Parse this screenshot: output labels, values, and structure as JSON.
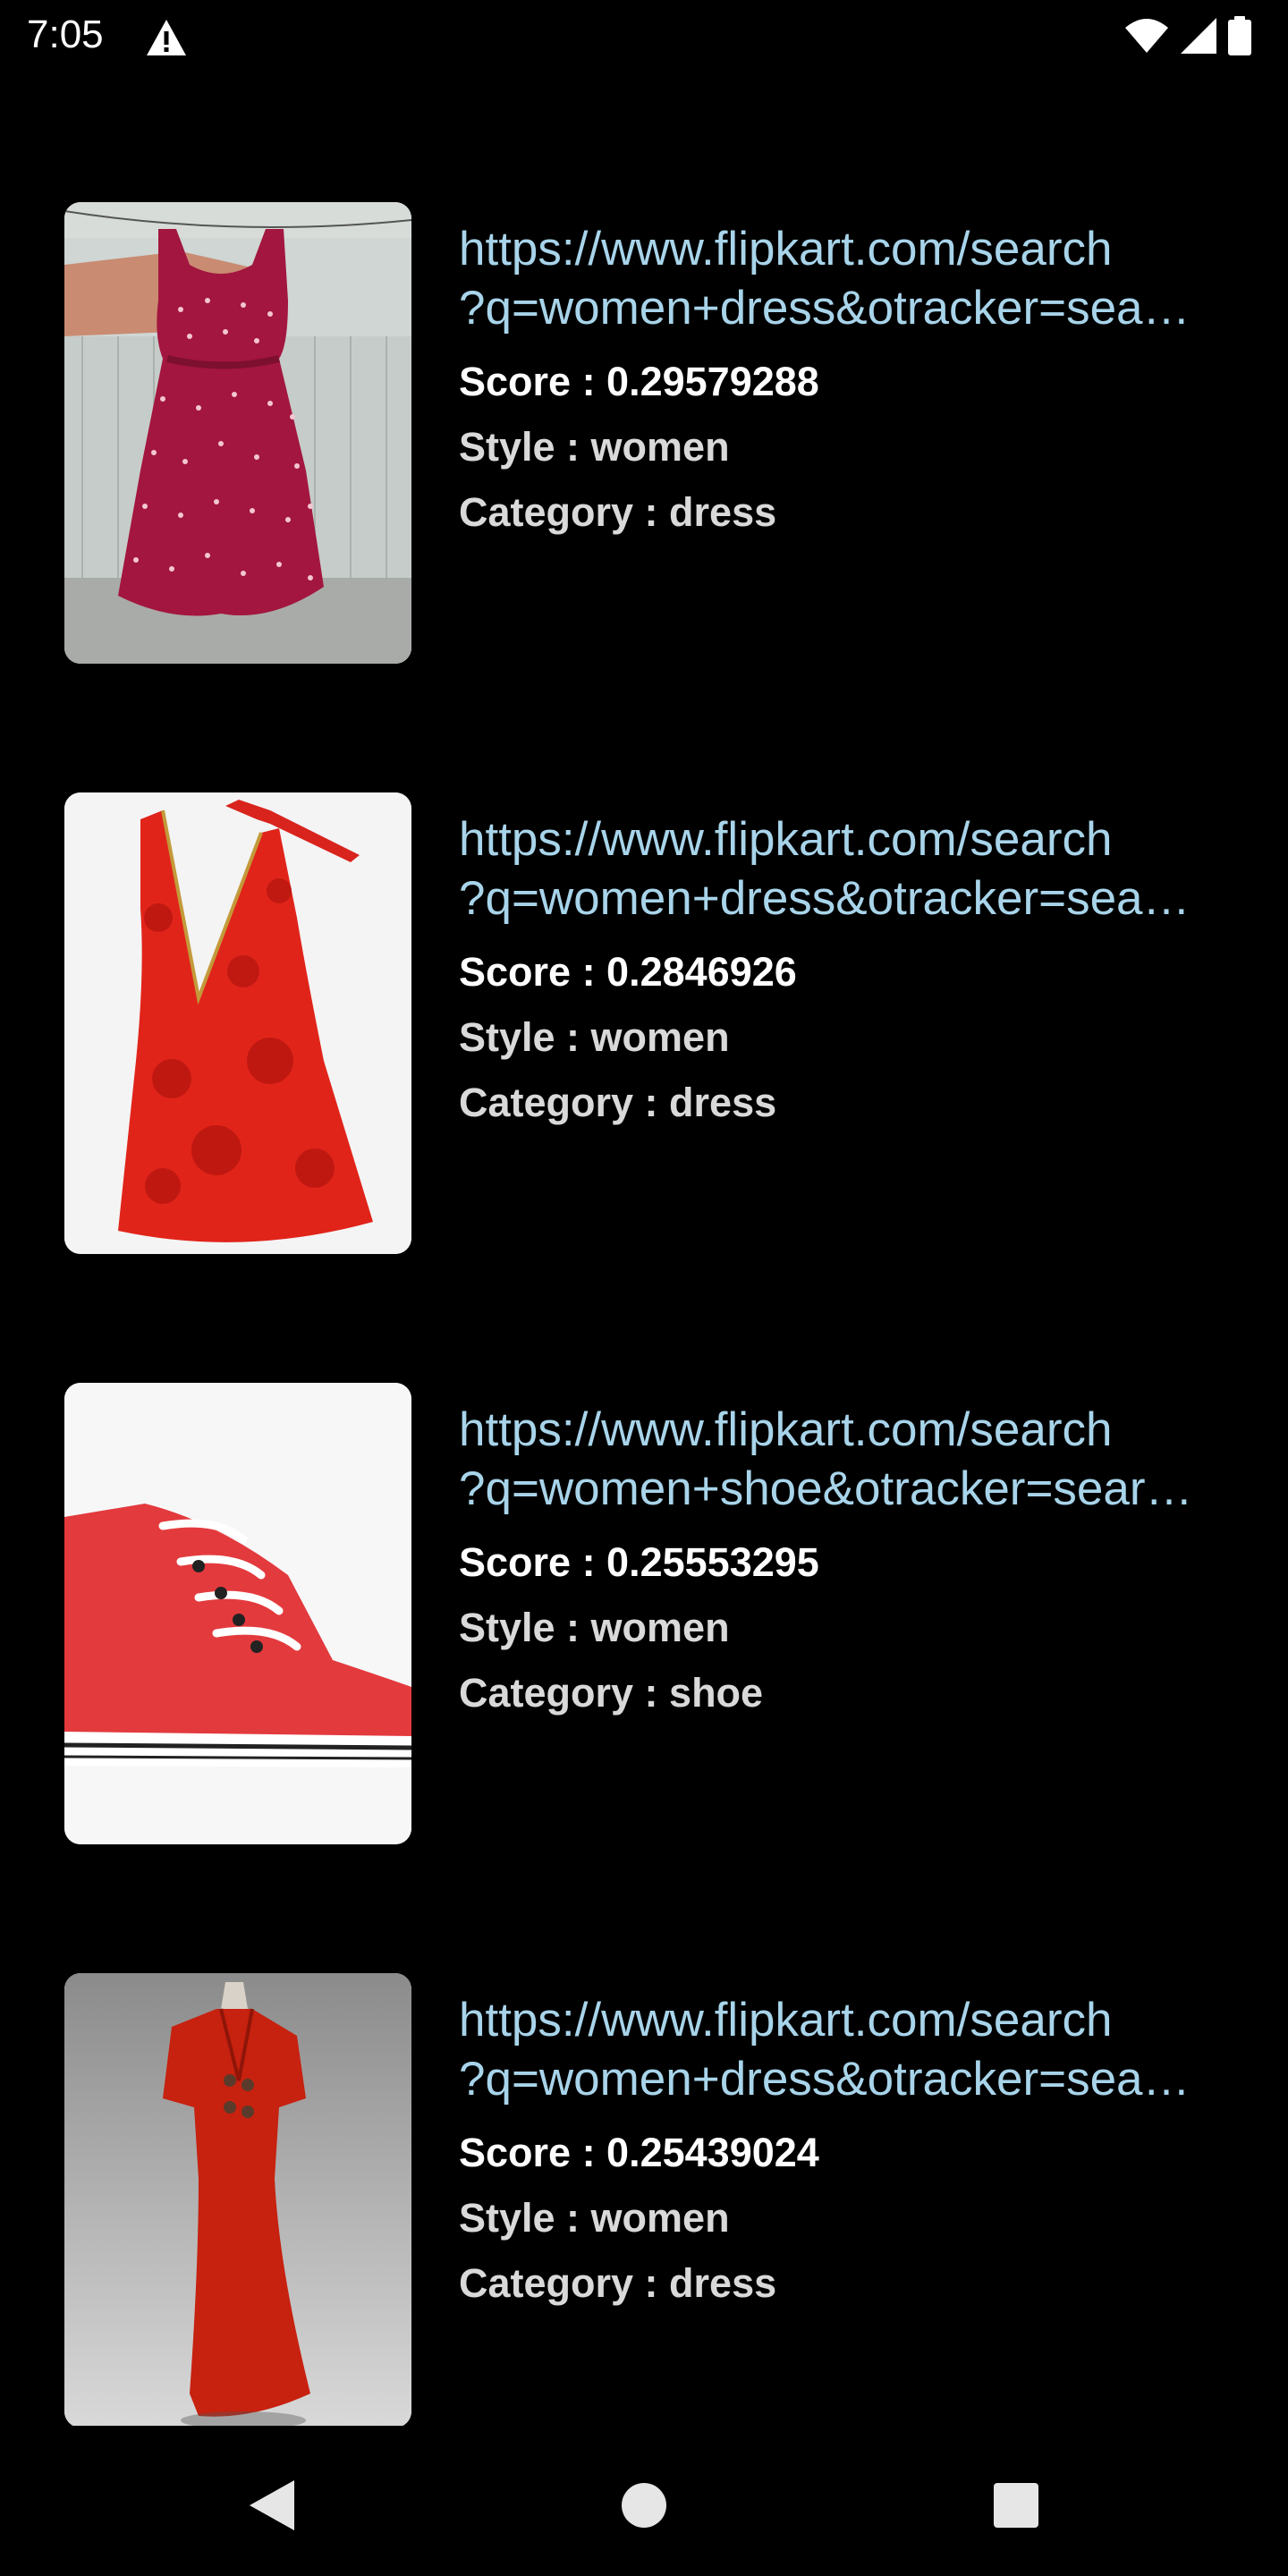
{
  "status_bar": {
    "time": "7:05",
    "icons": [
      "alert-icon",
      "wifi-icon",
      "signal-icon",
      "battery-icon"
    ]
  },
  "results": [
    {
      "url_line1": "https://www.flipkart.com/search",
      "url_line2": "?q=women+dress&otracker=sea…",
      "score": "Score : 0.29579288",
      "style": "Style : women",
      "category": "Category : dress",
      "image": "pink-polka-dot-dress"
    },
    {
      "url_line1": "https://www.flipkart.com/search",
      "url_line2": "?q=women+dress&otracker=sea…",
      "score": "Score : 0.2846926",
      "style": "Style : women",
      "category": "Category : dress",
      "image": "red-halter-dress"
    },
    {
      "url_line1": "https://www.flipkart.com/search",
      "url_line2": "?q=women+shoe&otracker=sear…",
      "score": "Score : 0.25553295",
      "style": "Style : women",
      "category": "Category : shoe",
      "image": "red-high-top-sneaker"
    },
    {
      "url_line1": "https://www.flipkart.com/search",
      "url_line2": "?q=women+dress&otracker=sea…",
      "score": "Score : 0.25439024",
      "style": "Style : women",
      "category": "Category : dress",
      "image": "red-long-dress-on-mannequin"
    }
  ],
  "nav_bar": {
    "icons": [
      "back-icon",
      "home-icon",
      "recents-icon"
    ]
  },
  "colors": {
    "background": "#000000",
    "link": "#a8d4ea",
    "meta_text": "#d9d9d9"
  }
}
